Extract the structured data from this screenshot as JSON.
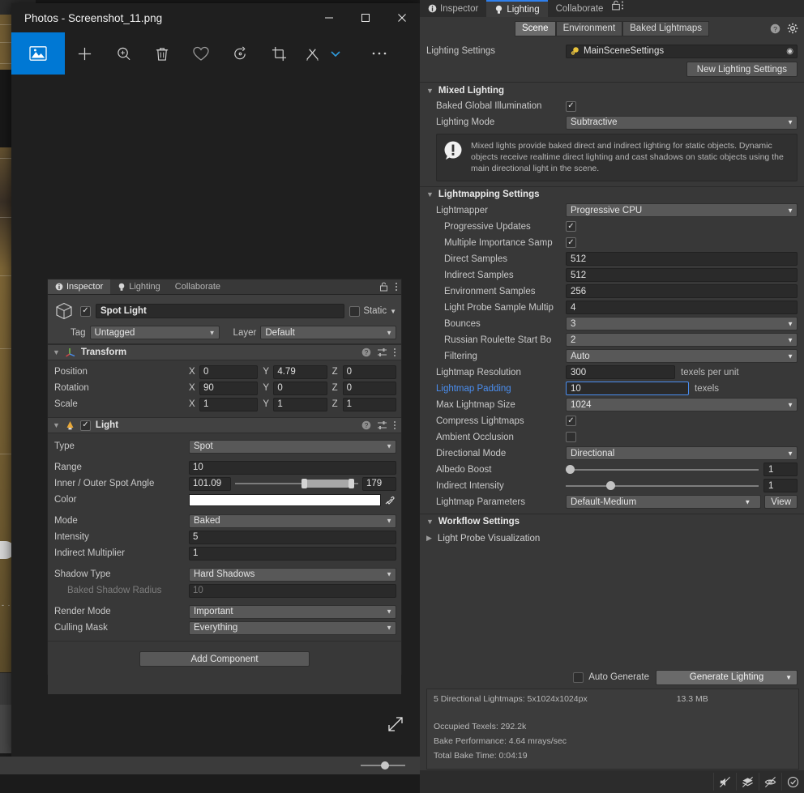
{
  "photos_window": {
    "title": "Photos - Screenshot_11.png",
    "window_buttons": {
      "minimize": "—",
      "maximize": "☐",
      "close": "✕"
    },
    "toolbar": [
      {
        "name": "image-view-icon",
        "label": "Image"
      },
      {
        "name": "add-icon",
        "label": "Add"
      },
      {
        "name": "zoom-icon",
        "label": "Zoom"
      },
      {
        "name": "delete-icon",
        "label": "Delete"
      },
      {
        "name": "favorite-icon",
        "label": "Add to favorites"
      },
      {
        "name": "rotate-icon",
        "label": "Rotate"
      },
      {
        "name": "crop-icon",
        "label": "Crop"
      },
      {
        "name": "edit-create-icon",
        "label": "Edit & Create"
      },
      {
        "name": "chevron-down-icon",
        "label": "More edit options"
      },
      {
        "name": "more-icon",
        "label": "See more"
      }
    ],
    "expand_label": "Expand"
  },
  "inspector": {
    "tabs": [
      {
        "label": "Inspector",
        "active": true,
        "icon": "info-icon"
      },
      {
        "label": "Lighting",
        "active": false,
        "icon": "bulb-icon"
      },
      {
        "label": "Collaborate",
        "active": false,
        "icon": ""
      }
    ],
    "header": {
      "enabled": true,
      "object_name": "Spot Light",
      "static_label": "Static",
      "tag_label": "Tag",
      "tag_value": "Untagged",
      "layer_label": "Layer",
      "layer_value": "Default"
    },
    "transform": {
      "title": "Transform",
      "rows": [
        {
          "label": "Position",
          "x": "0",
          "y": "4.79",
          "z": "0"
        },
        {
          "label": "Rotation",
          "x": "90",
          "y": "0",
          "z": "0"
        },
        {
          "label": "Scale",
          "x": "1",
          "y": "1",
          "z": "1"
        }
      ],
      "axis_labels": [
        "X",
        "Y",
        "Z"
      ]
    },
    "light": {
      "title": "Light",
      "enabled": true,
      "type_label": "Type",
      "type_value": "Spot",
      "range_label": "Range",
      "range_value": "10",
      "spot_angle_label": "Inner / Outer Spot Angle",
      "spot_inner": "101.09",
      "spot_outer": "179",
      "color_label": "Color",
      "color_value": "#FFFFFF",
      "mode_label": "Mode",
      "mode_value": "Baked",
      "intensity_label": "Intensity",
      "intensity_value": "5",
      "indirect_label": "Indirect Multiplier",
      "indirect_value": "1",
      "shadow_type_label": "Shadow Type",
      "shadow_type_value": "Hard Shadows",
      "baked_shadow_radius_label": "Baked Shadow Radius",
      "baked_shadow_radius_value": "10",
      "render_mode_label": "Render Mode",
      "render_mode_value": "Important",
      "culling_mask_label": "Culling Mask",
      "culling_mask_value": "Everything"
    },
    "add_component_label": "Add Component"
  },
  "lighting": {
    "tabs": [
      {
        "label": "Inspector",
        "active": false,
        "icon": "info-icon"
      },
      {
        "label": "Lighting",
        "active": true,
        "icon": "bulb-icon"
      },
      {
        "label": "Collaborate",
        "active": false,
        "icon": ""
      }
    ],
    "segments": [
      {
        "label": "Scene",
        "active": true
      },
      {
        "label": "Environment",
        "active": false
      },
      {
        "label": "Baked Lightmaps",
        "active": false
      }
    ],
    "settings_label": "Lighting Settings",
    "settings_value": "MainSceneSettings",
    "new_settings_label": "New Lighting Settings",
    "mixed_lighting": {
      "title": "Mixed Lighting",
      "baked_gi_label": "Baked Global Illumination",
      "baked_gi_checked": true,
      "lighting_mode_label": "Lighting Mode",
      "lighting_mode_value": "Subtractive",
      "help_text": "Mixed lights provide baked direct and indirect lighting for static objects. Dynamic objects receive realtime direct lighting and cast shadows on static objects using the main directional light in the scene."
    },
    "lightmapping": {
      "title": "Lightmapping Settings",
      "rows": [
        {
          "label": "Lightmapper",
          "value": "Progressive CPU",
          "kind": "dropdown",
          "indent": false
        },
        {
          "label": "Progressive Updates",
          "value": true,
          "kind": "checkbox",
          "indent": true
        },
        {
          "label": "Multiple Importance Samp",
          "value": true,
          "kind": "checkbox",
          "indent": true
        },
        {
          "label": "Direct Samples",
          "value": "512",
          "kind": "input",
          "indent": true
        },
        {
          "label": "Indirect Samples",
          "value": "512",
          "kind": "input",
          "indent": true
        },
        {
          "label": "Environment Samples",
          "value": "256",
          "kind": "input",
          "indent": true
        },
        {
          "label": "Light Probe Sample Multip",
          "value": "4",
          "kind": "input",
          "indent": true
        },
        {
          "label": "Bounces",
          "value": "3",
          "kind": "dropdown",
          "indent": true
        },
        {
          "label": "Russian Roulette Start Bo",
          "value": "2",
          "kind": "dropdown",
          "indent": true
        },
        {
          "label": "Filtering",
          "value": "Auto",
          "kind": "dropdown",
          "indent": true
        },
        {
          "label": "Lightmap Resolution",
          "value": "300",
          "kind": "input-unit",
          "unit": "texels per unit",
          "indent": false
        },
        {
          "label": "Lightmap Padding",
          "value": "10",
          "kind": "input-unit",
          "unit": "texels",
          "indent": false,
          "selected": true
        },
        {
          "label": "Max Lightmap Size",
          "value": "1024",
          "kind": "dropdown",
          "indent": false
        },
        {
          "label": "Compress Lightmaps",
          "value": true,
          "kind": "checkbox",
          "indent": false
        },
        {
          "label": "Ambient Occlusion",
          "value": false,
          "kind": "checkbox",
          "indent": false
        },
        {
          "label": "Directional Mode",
          "value": "Directional",
          "kind": "dropdown",
          "indent": false
        },
        {
          "label": "Albedo Boost",
          "value": "1",
          "kind": "slider",
          "pos": 0,
          "indent": false
        },
        {
          "label": "Indirect Intensity",
          "value": "1",
          "kind": "slider",
          "pos": 21,
          "indent": false
        },
        {
          "label": "Lightmap Parameters",
          "value": "Default-Medium",
          "kind": "dropdown-view",
          "view": "View",
          "indent": false
        }
      ]
    },
    "workflow": {
      "title": "Workflow Settings",
      "light_probe_viz_label": "Light Probe Visualization"
    },
    "generate": {
      "auto_generate_label": "Auto Generate",
      "auto_generate_checked": false,
      "generate_button_label": "Generate Lighting"
    },
    "stats": {
      "lightmaps_line": "5 Directional Lightmaps: 5x1024x1024px",
      "lightmaps_size": "13.3 MB",
      "occupied_texels": "Occupied Texels: 292.2k",
      "bake_performance": "Bake Performance: 4.64 mrays/sec",
      "total_bake_time": "Total Bake Time: 0:04:19"
    },
    "statusbar_icons": [
      {
        "name": "mute-audio-icon"
      },
      {
        "name": "layers-off-icon"
      },
      {
        "name": "gizmos-off-icon"
      },
      {
        "name": "check-circle-icon"
      }
    ]
  },
  "colors": {
    "accent_blue": "#0078d4",
    "unity_panel": "#383838",
    "selection_blue": "#4a8ef0",
    "light_color_swatch": "#FFFFFF"
  }
}
